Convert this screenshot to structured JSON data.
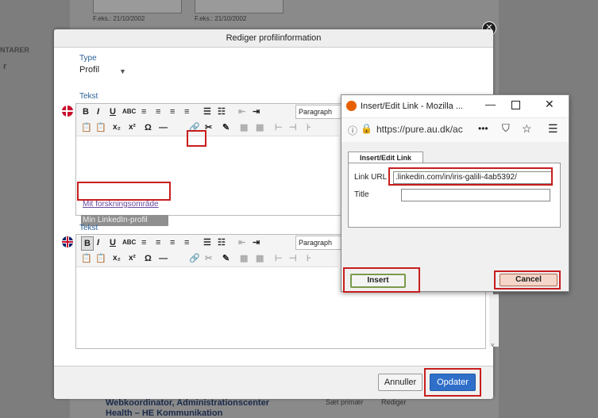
{
  "background": {
    "date_hint_1": "F.eks.: 21/10/2002",
    "date_hint_2": "F.eks.: 21/10/2002",
    "side_label": "NTARER",
    "side_letter": "r",
    "bottom_line_1": "Webkoordinator, Administrationscenter",
    "bottom_line_2": "Health – HE Kommunikation",
    "bottom_action_1": "Sæt primær",
    "bottom_action_2": "Rediger"
  },
  "dialog": {
    "title": "Rediger profilinformation",
    "type_label": "Type",
    "type_value": "Profil",
    "text_label_1": "Tekst",
    "text_label_2": "Tekst",
    "format_select": "Paragraph",
    "format_select_2": "Paragraph",
    "link_text": "Mit forskningsområde",
    "selected_text": "Min LinkedIn-profil",
    "cancel_label": "Annuller",
    "update_label": "Opdater"
  },
  "firefox_popup": {
    "title": "Insert/Edit Link - Mozilla ...",
    "url": "https://pure.au.dk/ac",
    "tab_label": "Insert/Edit Link",
    "link_url_label": "Link URL",
    "link_url_value": ".linkedin.com/in/iris-galili-4ab5392/",
    "title_label": "Title",
    "title_value": "",
    "insert_label": "Insert",
    "cancel_label": "Cancel"
  },
  "colors": {
    "highlight_red": "#c81e1e",
    "update_blue": "#2f6fc9",
    "label_blue": "#2a6099"
  }
}
